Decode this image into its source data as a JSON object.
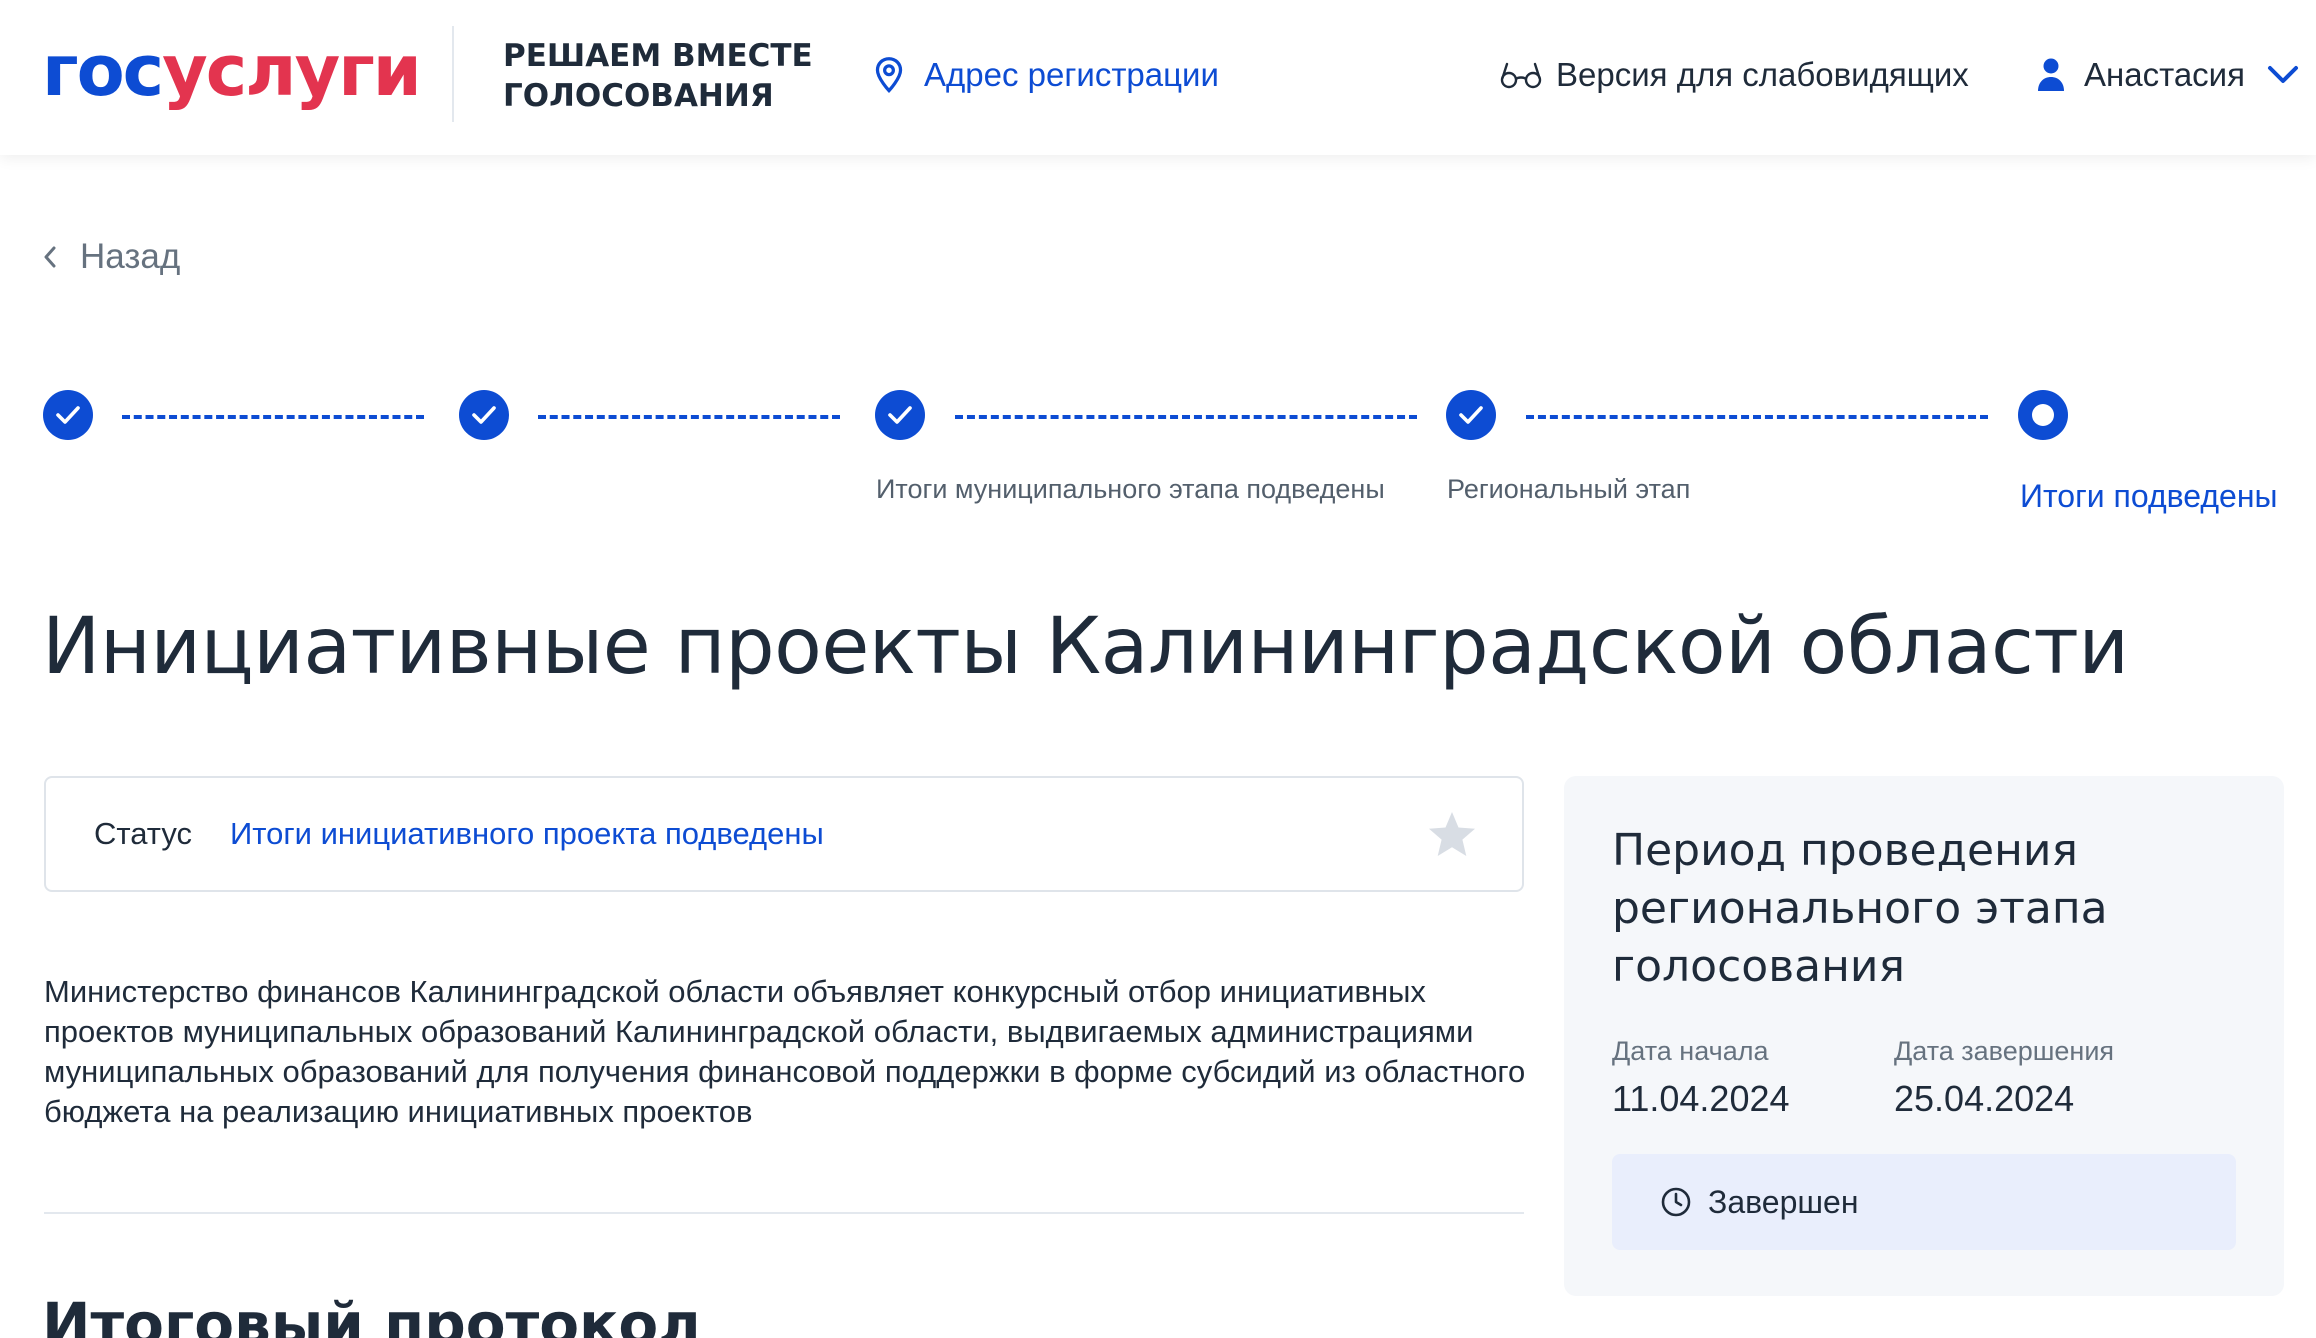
{
  "header": {
    "logo_part1": "гос",
    "logo_part2": "услуги",
    "tagline_line1": "РЕШАЕМ ВМЕСТЕ",
    "tagline_line2": "ГОЛОСОВАНИЯ",
    "address_link": "Адрес регистрации",
    "low_vision": "Версия для слабовидящих",
    "user_name": "Анастасия"
  },
  "back_label": "Назад",
  "stepper": {
    "steps": [
      {
        "label": "",
        "state": "done"
      },
      {
        "label": "",
        "state": "done"
      },
      {
        "label": "Итоги муниципального этапа подведены",
        "state": "done"
      },
      {
        "label": "Региональный этап",
        "state": "done"
      },
      {
        "label": "Итоги подведены",
        "state": "current"
      }
    ]
  },
  "page_title": "Инициативные проекты Калининградской области",
  "status": {
    "label": "Статус",
    "value": "Итоги инициативного проекта подведены"
  },
  "description": "Министерство финансов Калининградской области объявляет конкурсный отбор инициативных проектов муниципальных образований Калининградской области, выдвигаемых администрациями муниципальных образований для получения финансовой поддержки в форме субсидий из областного бюджета на реализацию инициативных проектов",
  "section_title": "Итоговый протокол",
  "period": {
    "title": "Период проведения регионального этапа голосования",
    "start_label": "Дата начала",
    "start_value": "11.04.2024",
    "end_label": "Дата завершения",
    "end_value": "25.04.2024",
    "state": "Завершен"
  },
  "colors": {
    "primary": "#0d4cd3",
    "logo_red": "#e3344f",
    "text": "#1f2b3a",
    "muted": "#66727f",
    "card_bg": "#f5f7fa",
    "badge_bg": "#e9eefc"
  },
  "icons": [
    "location-pin-icon",
    "glasses-icon",
    "user-icon",
    "chevron-down-icon",
    "chevron-left-icon",
    "check-icon",
    "star-icon",
    "clock-icon"
  ]
}
